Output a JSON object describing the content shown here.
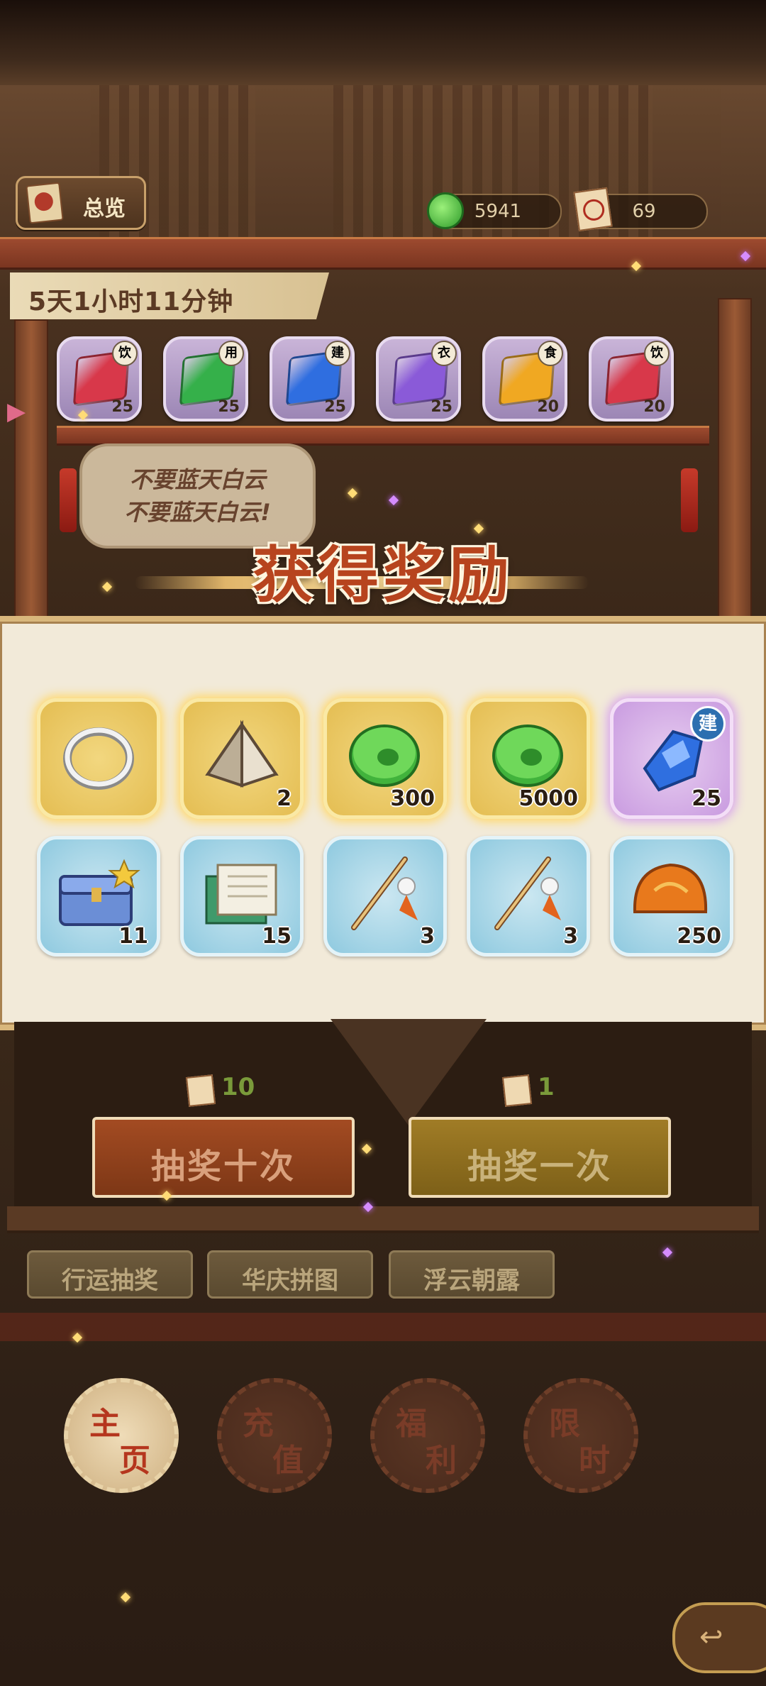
{
  "header": {
    "overview_label": "总览",
    "currencies": [
      {
        "name": "jade",
        "value": "5941"
      },
      {
        "name": "ticket",
        "value": "69"
      }
    ]
  },
  "event": {
    "timer": "5天1小时11分钟",
    "materials": [
      {
        "tag": "饮",
        "count": "25",
        "color": "#d8384a"
      },
      {
        "tag": "用",
        "count": "25",
        "color": "#35b04a"
      },
      {
        "tag": "建",
        "count": "25",
        "color": "#2f6ee0"
      },
      {
        "tag": "衣",
        "count": "25",
        "color": "#8a5ad8"
      },
      {
        "tag": "食",
        "count": "20",
        "color": "#f0a822"
      },
      {
        "tag": "饮",
        "count": "20",
        "color": "#d8384a"
      }
    ],
    "bubble_line1": "不要蓝天白云",
    "bubble_line2": "不要蓝天白云!"
  },
  "reward": {
    "title": "获得奖励",
    "items": [
      {
        "name": "silver-ring",
        "count": "",
        "rarity": "gold"
      },
      {
        "name": "tent",
        "count": "2",
        "rarity": "gold"
      },
      {
        "name": "jade",
        "count": "300",
        "rarity": "gold"
      },
      {
        "name": "jade",
        "count": "5000",
        "rarity": "gold"
      },
      {
        "name": "blue-crystal",
        "count": "25",
        "rarity": "purple",
        "tag": "建"
      },
      {
        "name": "treasure-box",
        "count": "11",
        "rarity": "blue"
      },
      {
        "name": "scroll",
        "count": "15",
        "rarity": "blue"
      },
      {
        "name": "fishing-rod",
        "count": "3",
        "rarity": "blue"
      },
      {
        "name": "fishing-rod",
        "count": "3",
        "rarity": "blue"
      },
      {
        "name": "amber-stone",
        "count": "250",
        "rarity": "blue"
      }
    ]
  },
  "draw": {
    "ten": {
      "cost": "10",
      "label": "抽奖十次"
    },
    "one": {
      "cost": "1",
      "label": "抽奖一次"
    }
  },
  "tabs": [
    "行运抽奖",
    "华庆拼图",
    "浮云朝露"
  ],
  "nav": [
    {
      "c1": "主",
      "c2": "页",
      "active": true
    },
    {
      "c1": "充",
      "c2": "值",
      "active": false
    },
    {
      "c1": "福",
      "c2": "利",
      "active": false
    },
    {
      "c1": "限",
      "c2": "时",
      "active": false
    }
  ]
}
